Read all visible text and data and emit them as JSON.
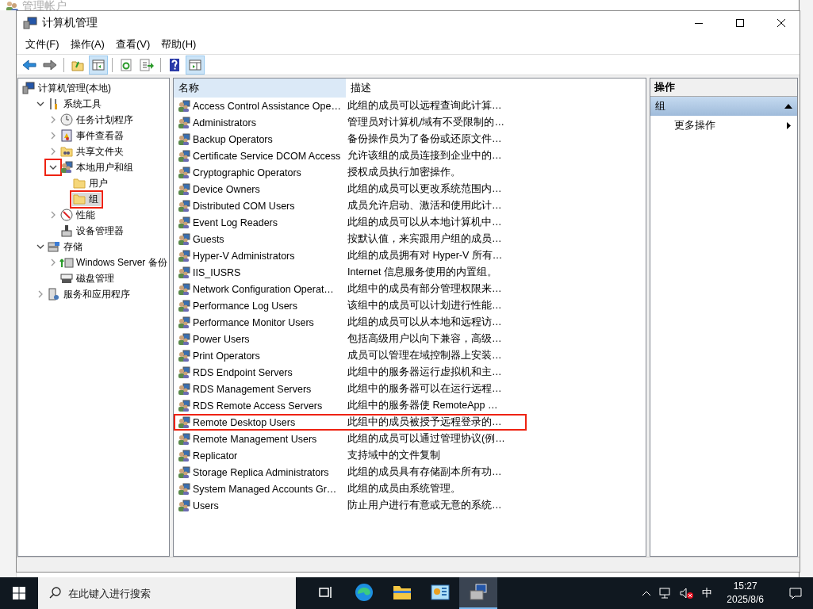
{
  "background_window": {
    "title": "管理帐户"
  },
  "window": {
    "title": "计算机管理"
  },
  "menu": [
    "文件(F)",
    "操作(A)",
    "查看(V)",
    "帮助(H)"
  ],
  "toolbar": [
    {
      "kind": "back",
      "pressed": false
    },
    {
      "kind": "forward",
      "pressed": false
    },
    {
      "kind": "sep"
    },
    {
      "kind": "up",
      "pressed": false
    },
    {
      "kind": "tree",
      "pressed": true
    },
    {
      "kind": "sep"
    },
    {
      "kind": "refresh",
      "pressed": false
    },
    {
      "kind": "export",
      "pressed": false
    },
    {
      "kind": "sep"
    },
    {
      "kind": "help",
      "pressed": false
    },
    {
      "kind": "actionpane",
      "pressed": true
    }
  ],
  "tree": [
    {
      "label": "计算机管理(本地)",
      "kind": "computer",
      "selected": false,
      "children": [
        {
          "label": "系统工具",
          "kind": "tools",
          "expanded": true,
          "selected": false,
          "children": [
            {
              "label": "任务计划程序",
              "kind": "clock",
              "expanded": false,
              "selected": false
            },
            {
              "label": "事件查看器",
              "kind": "log",
              "expanded": false,
              "selected": false
            },
            {
              "label": "共享文件夹",
              "kind": "share",
              "expanded": false,
              "selected": false
            },
            {
              "label": "本地用户和组",
              "kind": "users",
              "expanded": true,
              "selected": false,
              "toggle_highlighted": true,
              "children": [
                {
                  "label": "用户",
                  "kind": "folder",
                  "selected": false
                },
                {
                  "label": "组",
                  "kind": "folder",
                  "selected": true,
                  "highlighted": true
                }
              ]
            },
            {
              "label": "性能",
              "kind": "perf",
              "expanded": false,
              "selected": false
            },
            {
              "label": "设备管理器",
              "kind": "device",
              "selected": false
            }
          ]
        },
        {
          "label": "存储",
          "kind": "storage",
          "expanded": true,
          "selected": false,
          "children": [
            {
              "label": "Windows Server 备份",
              "kind": "backup",
              "expanded": false,
              "selected": false
            },
            {
              "label": "磁盘管理",
              "kind": "disk",
              "selected": false
            }
          ]
        },
        {
          "label": "服务和应用程序",
          "kind": "services",
          "expanded": false,
          "selected": false
        }
      ]
    }
  ],
  "table": {
    "columns": [
      "名称",
      "描述"
    ],
    "rows": [
      {
        "name": "Access Control Assistance Ope…",
        "description": "此组的成员可以远程查询此计算…"
      },
      {
        "name": "Administrators",
        "description": "管理员对计算机/域有不受限制的…"
      },
      {
        "name": "Backup Operators",
        "description": "备份操作员为了备份或还原文件…"
      },
      {
        "name": "Certificate Service DCOM Access",
        "description": "允许该组的成员连接到企业中的…"
      },
      {
        "name": "Cryptographic Operators",
        "description": "授权成员执行加密操作。"
      },
      {
        "name": "Device Owners",
        "description": "此组的成员可以更改系统范围内…"
      },
      {
        "name": "Distributed COM Users",
        "description": "成员允许启动、激活和使用此计…"
      },
      {
        "name": "Event Log Readers",
        "description": "此组的成员可以从本地计算机中…"
      },
      {
        "name": "Guests",
        "description": "按默认值，来宾跟用户组的成员…"
      },
      {
        "name": "Hyper-V Administrators",
        "description": "此组的成员拥有对 Hyper-V 所有…"
      },
      {
        "name": "IIS_IUSRS",
        "description": "Internet 信息服务使用的内置组。"
      },
      {
        "name": "Network Configuration Operat…",
        "description": "此组中的成员有部分管理权限来…"
      },
      {
        "name": "Performance Log Users",
        "description": "该组中的成员可以计划进行性能…"
      },
      {
        "name": "Performance Monitor Users",
        "description": "此组的成员可以从本地和远程访…"
      },
      {
        "name": "Power Users",
        "description": "包括高级用户以向下兼容，高级…"
      },
      {
        "name": "Print Operators",
        "description": "成员可以管理在域控制器上安装…"
      },
      {
        "name": "RDS Endpoint Servers",
        "description": "此组中的服务器运行虚拟机和主…"
      },
      {
        "name": "RDS Management Servers",
        "description": "此组中的服务器可以在运行远程…"
      },
      {
        "name": "RDS Remote Access Servers",
        "description": "此组中的服务器使 RemoteApp …"
      },
      {
        "name": "Remote Desktop Users",
        "description": "此组中的成员被授予远程登录的…",
        "highlighted": true
      },
      {
        "name": "Remote Management Users",
        "description": "此组的成员可以通过管理协议(例…"
      },
      {
        "name": "Replicator",
        "description": "支持域中的文件复制"
      },
      {
        "name": "Storage Replica Administrators",
        "description": "此组的成员具有存储副本所有功…"
      },
      {
        "name": "System Managed Accounts Gr…",
        "description": "此组的成员由系统管理。"
      },
      {
        "name": "Users",
        "description": "防止用户进行有意或无意的系统…"
      }
    ]
  },
  "actions": {
    "title": "操作",
    "section": {
      "label": "组",
      "expanded": true
    },
    "items": [
      "更多操作"
    ]
  },
  "taskbar": {
    "search": {
      "placeholder": "在此键入进行搜索"
    },
    "apps": [
      {
        "kind": "taskview",
        "active": false
      },
      {
        "kind": "edge",
        "active": false
      },
      {
        "kind": "explorer",
        "active": false
      },
      {
        "kind": "panel",
        "active": false
      },
      {
        "kind": "mmc",
        "active": true
      }
    ],
    "ime": "中",
    "time": "15:27",
    "date": "2025/8/6"
  }
}
